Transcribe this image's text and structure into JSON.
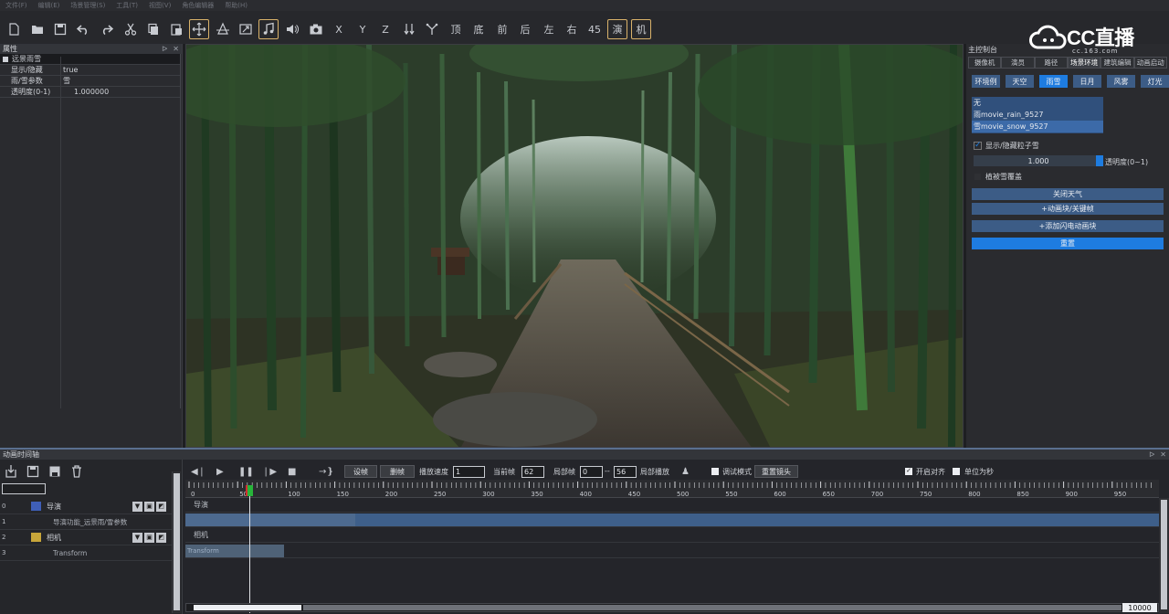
{
  "menu": {
    "items": [
      "文件(F)",
      "编辑(E)",
      "场景管理(S)",
      "工具(T)",
      "视图(V)",
      "角色编辑器",
      "帮助(H)"
    ]
  },
  "toolbar": {
    "axis_x": "X",
    "axis_y": "Y",
    "axis_z": "Z",
    "view_top": "顶",
    "view_bottom": "底",
    "view_front": "前",
    "view_back": "后",
    "view_left": "左",
    "view_right": "右",
    "view_45": "45",
    "mode_director": "演",
    "mode_camera": "机"
  },
  "logo": {
    "brand": "CC直播",
    "sub": "cc.163.com"
  },
  "properties": {
    "title": "属性",
    "group": "远景雨雪",
    "rows": [
      {
        "key": "显示/隐藏",
        "value": "true"
      },
      {
        "key": "雨/雪参数",
        "value": "雪"
      },
      {
        "key": "透明度(0-1)",
        "value": "1.000000"
      }
    ]
  },
  "control": {
    "title": "主控制台",
    "tabs": [
      "摄像机",
      "演员",
      "路径",
      "场景环境",
      "建筑编辑",
      "动画启动"
    ],
    "active_tab": "场景环境",
    "subtabs": [
      "环境例",
      "天空",
      "雨雪",
      "日月",
      "风雾",
      "灯光"
    ],
    "active_subtab": "雨雪",
    "list": [
      "无",
      "雨movie_rain_9527",
      "雪movie_snow_9527"
    ],
    "show_particles_label": "显示/隐藏粒子雪",
    "opacity_value": "1.000",
    "opacity_label": "透明度(0~1)",
    "snow_cover_label": "植被雪覆盖",
    "btn_close_weather": "关闭天气",
    "btn_add_keyframe": "+动画块/关键帧",
    "btn_add_lightning": "+添加闪电动画块",
    "btn_reset": "重置"
  },
  "timeline": {
    "title": "动画时间轴",
    "set_frame": "设帧",
    "delete_frame": "删帧",
    "speed_label": "播放速度",
    "speed_value": "1",
    "current_label": "当前帧",
    "current_value": "62",
    "local_label": "局部帧",
    "local_from": "0",
    "local_sep": "--",
    "local_to": "56",
    "local_play": "局部播放",
    "debug_mode": "调试模式",
    "reset_lens": "重置镜头",
    "snap_on": "开启对齐",
    "unit_seconds": "单位为秒",
    "ruler_labels": [
      "0",
      "50",
      "100",
      "150",
      "200",
      "250",
      "300",
      "350",
      "400",
      "450",
      "500",
      "550",
      "600",
      "650",
      "700",
      "750",
      "800",
      "850",
      "900",
      "950"
    ],
    "end_value": "10000",
    "tracks": [
      {
        "idx": "0",
        "name": "导演",
        "color": "#3f5fb8"
      },
      {
        "idx": "1",
        "name": "导演功能_远景雨/雪参数"
      },
      {
        "idx": "2",
        "name": "相机",
        "color": "#c8a63a"
      },
      {
        "idx": "3",
        "name": "Transform"
      }
    ],
    "lanes": [
      "导演",
      "",
      "相机",
      "Transform"
    ]
  }
}
